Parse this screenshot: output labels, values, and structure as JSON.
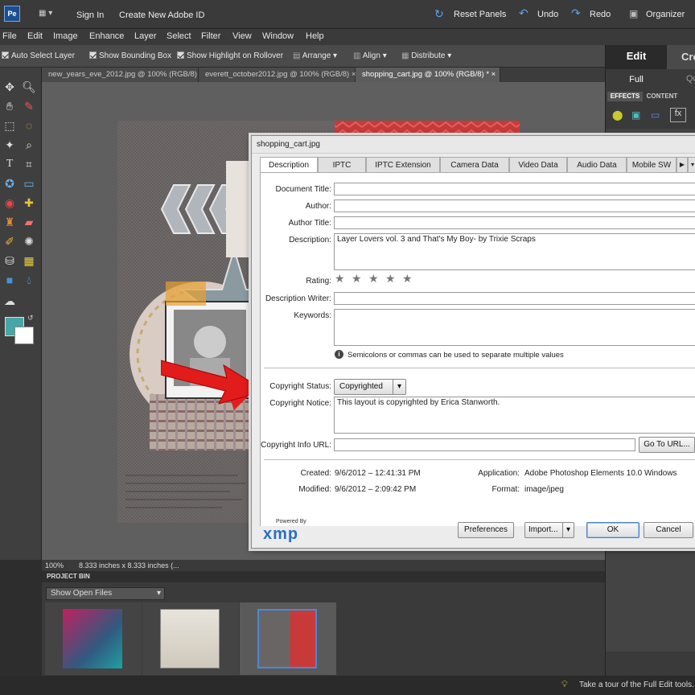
{
  "topbar": {
    "sign_in": "Sign In",
    "create_id": "Create New Adobe ID",
    "reset_panels": "Reset Panels",
    "undo": "Undo",
    "redo": "Redo",
    "organizer": "Organizer"
  },
  "menu": [
    "File",
    "Edit",
    "Image",
    "Enhance",
    "Layer",
    "Select",
    "Filter",
    "View",
    "Window",
    "Help"
  ],
  "options": {
    "auto_select": "Auto Select Layer",
    "bounding_box": "Show Bounding Box",
    "highlight": "Show Highlight on Rollover",
    "arrange": "Arrange",
    "align": "Align",
    "distribute": "Distribute"
  },
  "doc_tabs": [
    {
      "label": "new_years_eve_2012.jpg @ 100% (RGB/8)"
    },
    {
      "label": "everett_october2012.jpg @ 100% (RGB/8)"
    },
    {
      "label": "shopping_cart.jpg @ 100% (RGB/8) *"
    }
  ],
  "status": {
    "zoom": "100%",
    "size": "8.333 inches x 8.333 inches (..."
  },
  "project_bin": {
    "title": "PROJECT BIN",
    "dropdown": "Show Open Files"
  },
  "right_panel": {
    "mode_edit": "Edit",
    "mode_create": "Cre",
    "full": "Full",
    "quick": "Qu",
    "effects_tab": "EFFECTS",
    "content_tab": "CONTENT"
  },
  "bottom_tip": "Take a tour of the Full Edit tools. Clic",
  "dialog": {
    "title": "shopping_cart.jpg",
    "tabs": [
      "Description",
      "IPTC",
      "IPTC Extension",
      "Camera Data",
      "Video Data",
      "Audio Data",
      "Mobile SW"
    ],
    "labels": {
      "doc_title": "Document Title:",
      "author": "Author:",
      "author_title": "Author Title:",
      "description": "Description:",
      "rating": "Rating:",
      "desc_writer": "Description Writer:",
      "keywords": "Keywords:",
      "copyright_status": "Copyright Status:",
      "copyright_notice": "Copyright Notice:",
      "copyright_url": "Copyright Info URL:",
      "created": "Created:",
      "modified": "Modified:",
      "application": "Application:",
      "format": "Format:"
    },
    "values": {
      "description": "Layer Lovers vol. 3 and That's My Boy- by Trixie Scraps",
      "keywords_hint": "Semicolons or commas can be used to separate multiple values",
      "copyright_status": "Copyrighted",
      "copyright_notice": "This layout is copyrighted by Erica Stanworth.",
      "created": "9/6/2012 – 12:41:31 PM",
      "modified": "9/6/2012 – 2:09:42 PM",
      "application": "Adobe Photoshop Elements 10.0 Windows",
      "format": "image/jpeg"
    },
    "rating_stars": 5,
    "buttons": {
      "go_to_url": "Go To URL...",
      "preferences": "Preferences",
      "import": "Import...",
      "ok": "OK",
      "cancel": "Cancel"
    },
    "powered_by": "Powered By",
    "xmp": "xmp"
  }
}
